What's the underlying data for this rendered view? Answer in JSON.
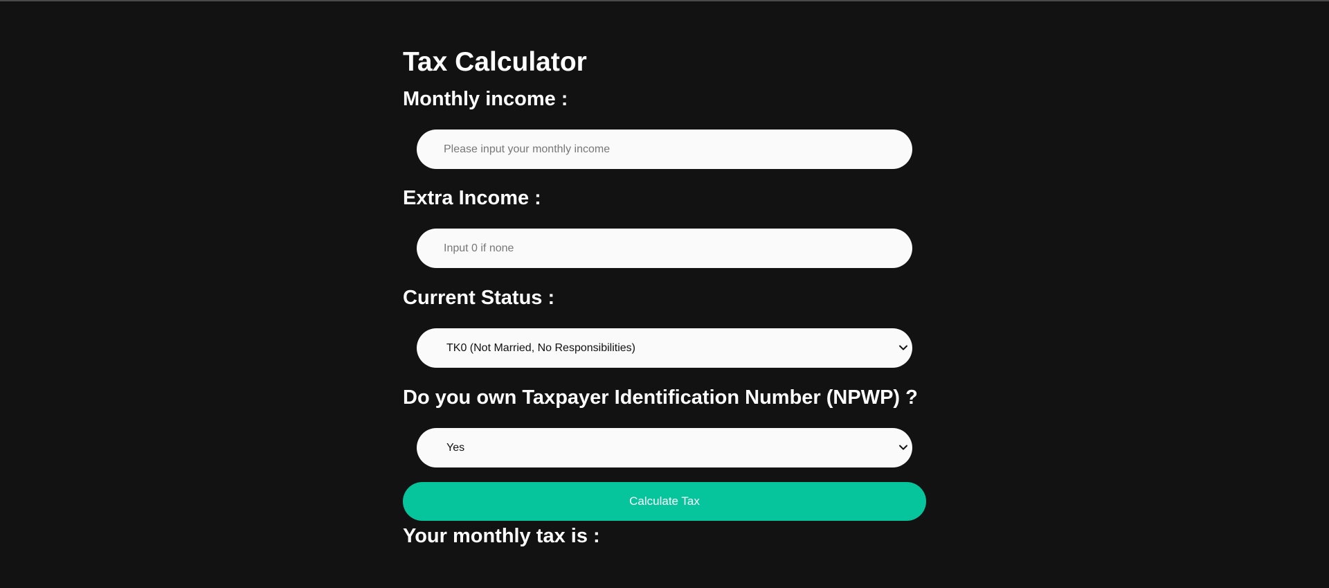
{
  "header": {
    "title": "Tax Calculator"
  },
  "form": {
    "monthly_income": {
      "label": "Monthly income :",
      "placeholder": "Please input your monthly income",
      "value": ""
    },
    "extra_income": {
      "label": "Extra Income :",
      "placeholder": "Input 0 if none",
      "value": ""
    },
    "current_status": {
      "label": "Current Status :",
      "selected": "TK0 (Not Married, No Responsibilities)"
    },
    "npwp": {
      "label": "Do you own Taxpayer Identification Number (NPWP) ?",
      "selected": "Yes"
    },
    "calculate_label": "Calculate Tax"
  },
  "result": {
    "label": "Your monthly tax is :"
  },
  "colors": {
    "background": "#121212",
    "accent": "#06c49c",
    "field": "#fafafa"
  },
  "icons": {
    "select_arrow": "chevron-down-icon"
  }
}
